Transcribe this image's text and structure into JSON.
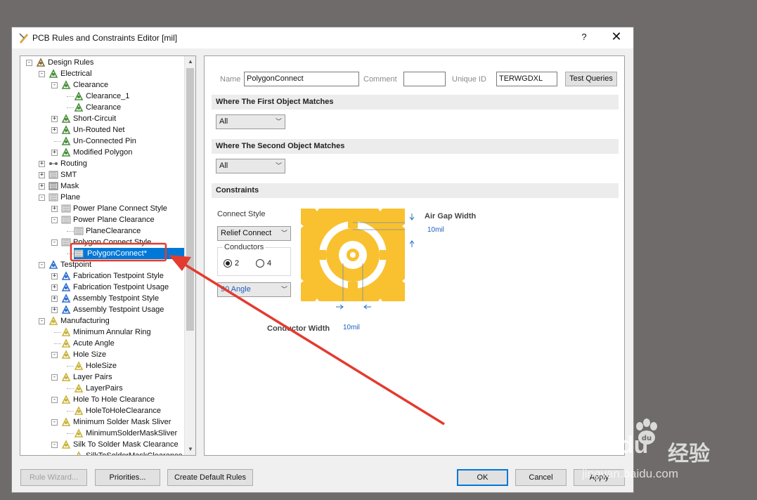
{
  "dialog": {
    "title": "PCB Rules and Constraints Editor [mil]",
    "help_label": "?",
    "close_label": "✕"
  },
  "tree": {
    "nodes": [
      {
        "label": "Design Rules",
        "icon": "design-rules-icon"
      },
      {
        "label": "Electrical",
        "icon": "electrical-icon"
      },
      {
        "label": "Clearance",
        "icon": "clearance-icon"
      },
      {
        "label": "Clearance_1",
        "icon": "rule-icon"
      },
      {
        "label": "Clearance",
        "icon": "rule-icon"
      },
      {
        "label": "Short-Circuit",
        "icon": "short-circuit-icon"
      },
      {
        "label": "Un-Routed Net",
        "icon": "unrouted-net-icon"
      },
      {
        "label": "Un-Connected Pin",
        "icon": "unconnected-pin-icon"
      },
      {
        "label": "Modified Polygon",
        "icon": "modified-polygon-icon"
      },
      {
        "label": "Routing",
        "icon": "routing-icon"
      },
      {
        "label": "SMT",
        "icon": "smt-icon"
      },
      {
        "label": "Mask",
        "icon": "mask-icon"
      },
      {
        "label": "Plane",
        "icon": "plane-icon"
      },
      {
        "label": "Power Plane Connect Style",
        "icon": "plane-rule-icon"
      },
      {
        "label": "Power Plane Clearance",
        "icon": "plane-rule-icon"
      },
      {
        "label": "PlaneClearance",
        "icon": "plane-rule-icon"
      },
      {
        "label": "Polygon Connect Style",
        "icon": "plane-rule-icon"
      },
      {
        "label": "PolygonConnect*",
        "icon": "plane-rule-icon"
      },
      {
        "label": "Testpoint",
        "icon": "testpoint-icon"
      },
      {
        "label": "Fabrication Testpoint Style",
        "icon": "testpoint-icon"
      },
      {
        "label": "Fabrication Testpoint Usage",
        "icon": "testpoint-icon"
      },
      {
        "label": "Assembly Testpoint Style",
        "icon": "testpoint-icon"
      },
      {
        "label": "Assembly Testpoint Usage",
        "icon": "testpoint-icon"
      },
      {
        "label": "Manufacturing",
        "icon": "manufacturing-icon"
      },
      {
        "label": "Minimum Annular Ring",
        "icon": "manufacturing-icon"
      },
      {
        "label": "Acute Angle",
        "icon": "manufacturing-icon"
      },
      {
        "label": "Hole Size",
        "icon": "manufacturing-icon"
      },
      {
        "label": "HoleSize",
        "icon": "manufacturing-icon"
      },
      {
        "label": "Layer Pairs",
        "icon": "manufacturing-icon"
      },
      {
        "label": "LayerPairs",
        "icon": "manufacturing-icon"
      },
      {
        "label": "Hole To Hole Clearance",
        "icon": "manufacturing-icon"
      },
      {
        "label": "HoleToHoleClearance",
        "icon": "manufacturing-icon"
      },
      {
        "label": "Minimum Solder Mask Sliver",
        "icon": "manufacturing-icon"
      },
      {
        "label": "MinimumSolderMaskSliver",
        "icon": "manufacturing-icon"
      },
      {
        "label": "Silk To Solder Mask Clearance",
        "icon": "manufacturing-icon"
      },
      {
        "label": "SilkToSolderMaskClearance",
        "icon": "manufacturing-icon"
      }
    ]
  },
  "rule": {
    "name_label": "Name",
    "name_value": "PolygonConnect",
    "comment_label": "Comment",
    "comment_value": "",
    "uid_label": "Unique ID",
    "uid_value": "TERWGDXL",
    "test_queries_label": "Test Queries"
  },
  "first_match": {
    "header": "Where The First Object Matches",
    "value": "All"
  },
  "second_match": {
    "header": "Where The Second Object Matches",
    "value": "All"
  },
  "constraints": {
    "header": "Constraints",
    "connect_style_label": "Connect Style",
    "connect_style_value": "Relief Connect",
    "conductors_label": "Conductors",
    "conductor_2": "2",
    "conductor_4": "4",
    "conductor_selected": "2",
    "angle_value": "90 Angle",
    "air_gap_label": "Air Gap Width",
    "air_gap_value": "10mil",
    "conductor_width_label": "Conductor Width",
    "conductor_width_value": "10mil"
  },
  "footer": {
    "rule_wizard": "Rule Wizard...",
    "priorities": "Priorities...",
    "create_default": "Create Default Rules",
    "ok": "OK",
    "cancel": "Cancel",
    "apply": "Apply"
  },
  "watermark": {
    "brand_text": "Baidu",
    "jingyan_text": "经验",
    "url_text": "jingyan.baidu.com"
  },
  "colors": {
    "selection": "#0078d7",
    "pad_yellow": "#f9c12f",
    "annotation_red": "#e33b2e"
  }
}
